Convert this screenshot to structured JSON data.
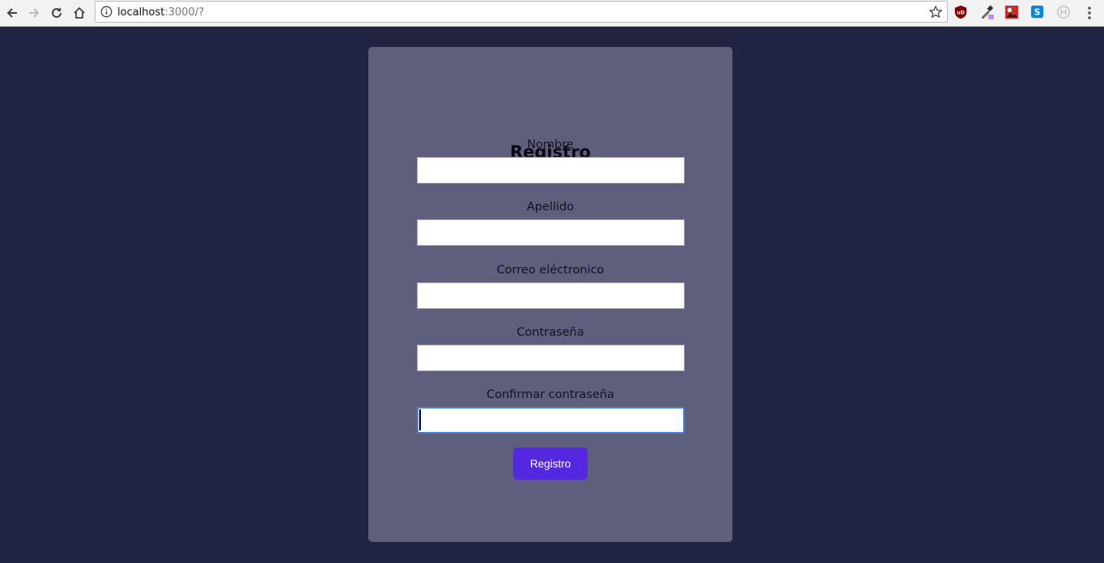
{
  "browser": {
    "url_host": "localhost",
    "url_rest": ":3000/?",
    "icons": [
      "back-icon",
      "forward-icon",
      "reload-icon",
      "home-icon",
      "site-info-icon",
      "bookmark-star-icon",
      "menu-icon"
    ],
    "extensions": [
      "ublock-extension-icon",
      "eyedropper-extension-icon",
      "image-extension-icon",
      "skype-extension-icon",
      "hypothesis-extension-icon"
    ]
  },
  "form": {
    "title": "Registro",
    "fields": [
      {
        "label": "Nombre",
        "value": ""
      },
      {
        "label": "Apellido",
        "value": ""
      },
      {
        "label": "Correo eléctronico",
        "value": ""
      },
      {
        "label": "Contraseña",
        "value": ""
      },
      {
        "label": "Confirmar contraseña",
        "value": ""
      }
    ],
    "submit_label": "Registro"
  },
  "colors": {
    "page_background": "#202341",
    "card_background": "#5d5f7d",
    "button_background": "#5428df",
    "focus_border": "#4a7fd4"
  }
}
